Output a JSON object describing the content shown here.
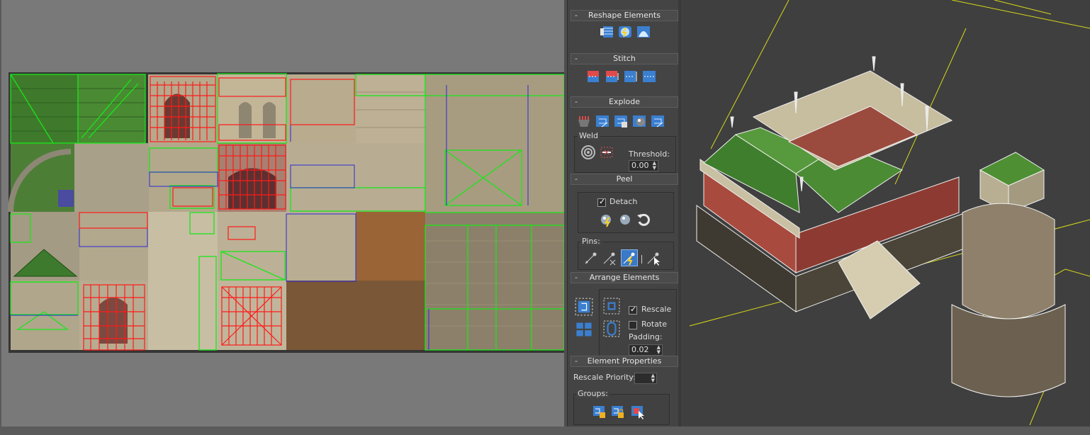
{
  "rollouts": {
    "reshape": {
      "title": "Reshape Elements",
      "collapse": "-"
    },
    "stitch": {
      "title": "Stitch",
      "collapse": "-"
    },
    "explode": {
      "title": "Explode",
      "collapse": "-",
      "weld_label": "Weld",
      "threshold_label": "Threshold:",
      "threshold_value": "0.00"
    },
    "peel": {
      "title": "Peel",
      "collapse": "-",
      "detach_label": "Detach",
      "detach_checked": true,
      "pins_label": "Pins:"
    },
    "arrange": {
      "title": "Arrange Elements",
      "collapse": "-",
      "rescale_label": "Rescale",
      "rescale_checked": true,
      "rotate_label": "Rotate",
      "rotate_checked": false,
      "padding_label": "Padding:",
      "padding_value": "0.02"
    },
    "element_props": {
      "title": "Element Properties",
      "collapse": "-",
      "rescale_priority_label": "Rescale Priority:",
      "rescale_priority_value": "",
      "groups_label": "Groups:"
    }
  },
  "icons": {
    "reshape": [
      "straighten-icon",
      "relax-icon",
      "arc-icon"
    ],
    "stitch": [
      "stitch-to-target-icon",
      "stitch-to-source-icon",
      "stitch-average-icon",
      "stitch-custom-icon"
    ],
    "explode": [
      "break-icon",
      "flatten-by-polygon-icon",
      "flatten-by-smoothing-icon",
      "flatten-by-material-icon",
      "flatten-to-sphere-icon",
      "stitch-elements-icon"
    ],
    "weld": [
      "weld-target-icon",
      "weld-selected-icon"
    ],
    "peel": [
      "quick-peel-icon",
      "peel-mode-icon",
      "reset-peel-icon"
    ],
    "pins": [
      "pin-icon",
      "unpin-icon",
      "auto-pin-icon",
      "pin-select-icon"
    ],
    "arrange": [
      "pack-normalize-icon",
      "pack-custom-icon",
      "pack-together-icon",
      "pack-tight-icon"
    ],
    "groups": [
      "group-selected-icon",
      "ungroup-selected-icon",
      "group-select-icon"
    ]
  },
  "colors": {
    "seam_green": "#19e619",
    "selected_red": "#ff1a1a",
    "edge_blue": "#2a2ad6",
    "viewport_grid": "#d8d81a",
    "active_pin": "#3a78c8"
  }
}
